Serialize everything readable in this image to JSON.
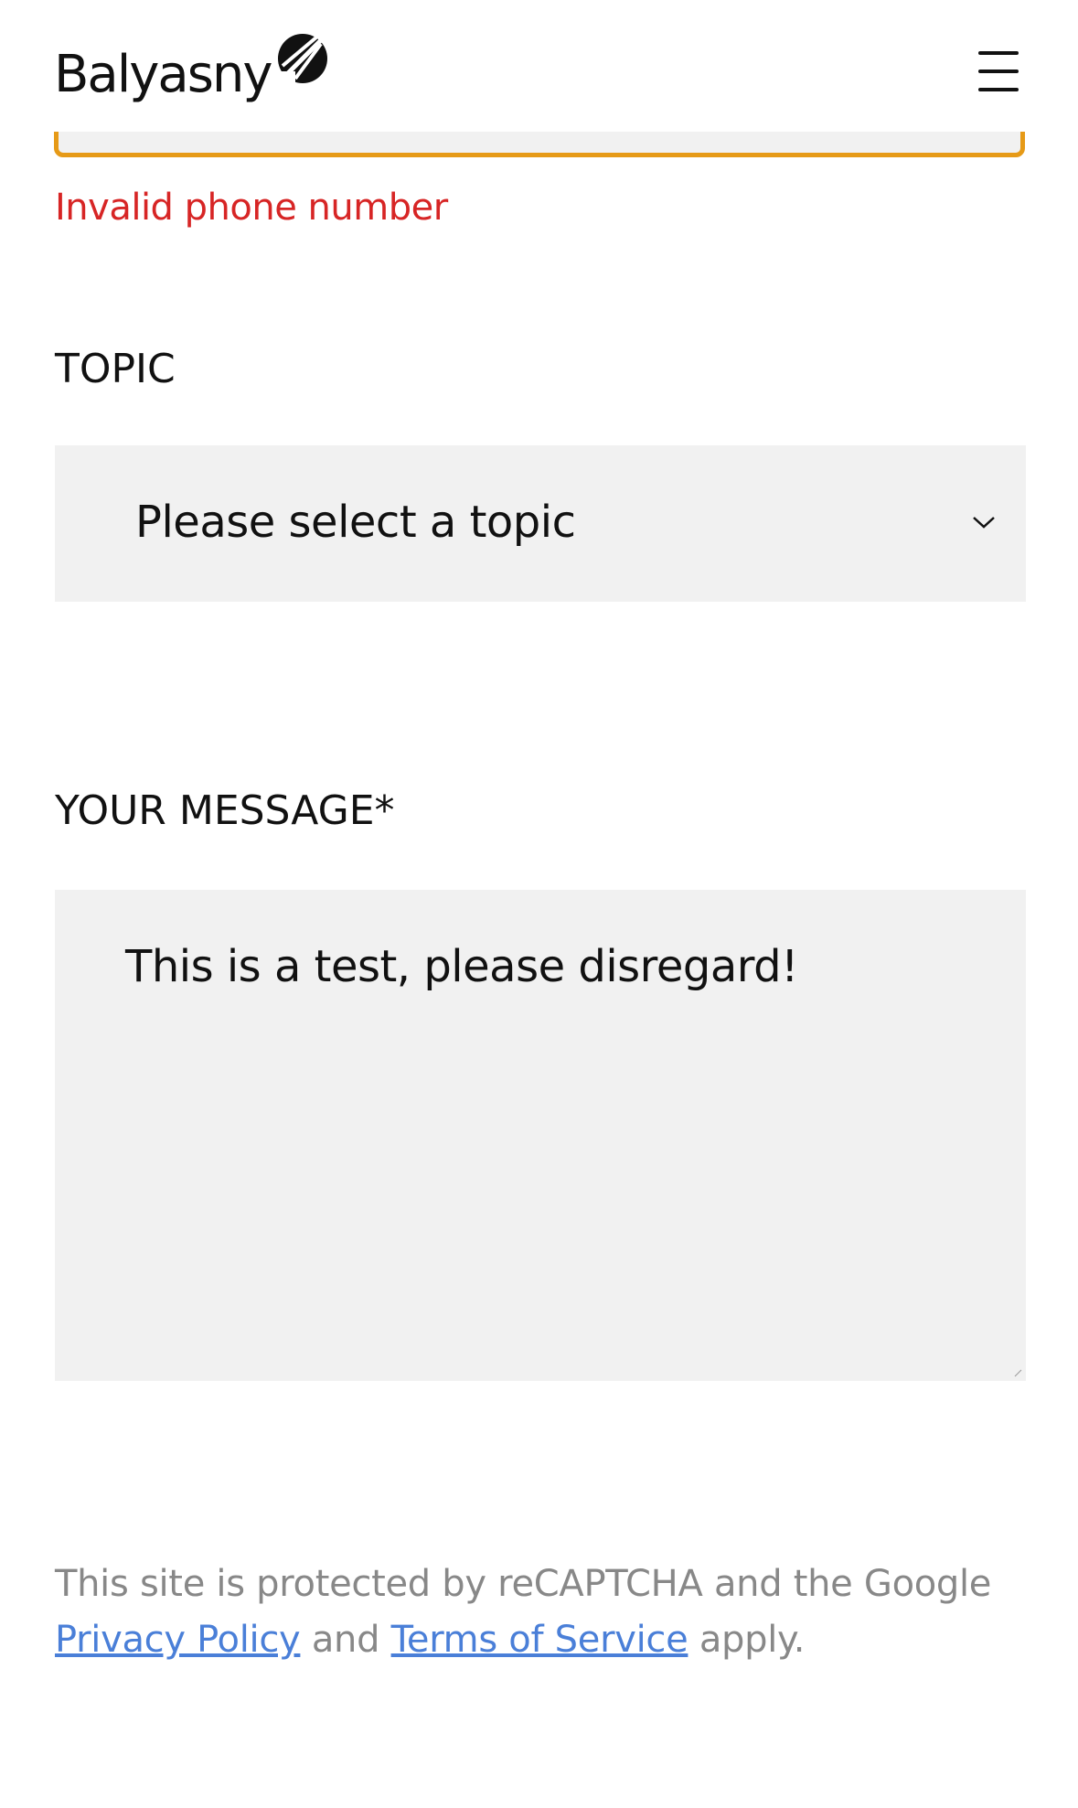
{
  "header": {
    "brand": "Balyasny",
    "menu_icon": "hamburger-menu-icon",
    "logo_icon": "balyasny-mark-icon"
  },
  "form": {
    "phone": {
      "error": "Invalid phone number",
      "border_color": "#e69a17",
      "error_color": "#d72525"
    },
    "topic": {
      "label": "TOPIC",
      "selected": "Please select a topic",
      "icon": "chevron-down-icon"
    },
    "message": {
      "label": "YOUR MESSAGE*",
      "value": "This is a test, please disregard!"
    }
  },
  "recaptcha": {
    "text_before": "This site is protected by reCAPTCHA and the Google ",
    "privacy_link": "Privacy Policy",
    "middle": " and ",
    "terms_link": "Terms of Service",
    "text_after": " apply.",
    "link_color": "#4a7fd8"
  }
}
